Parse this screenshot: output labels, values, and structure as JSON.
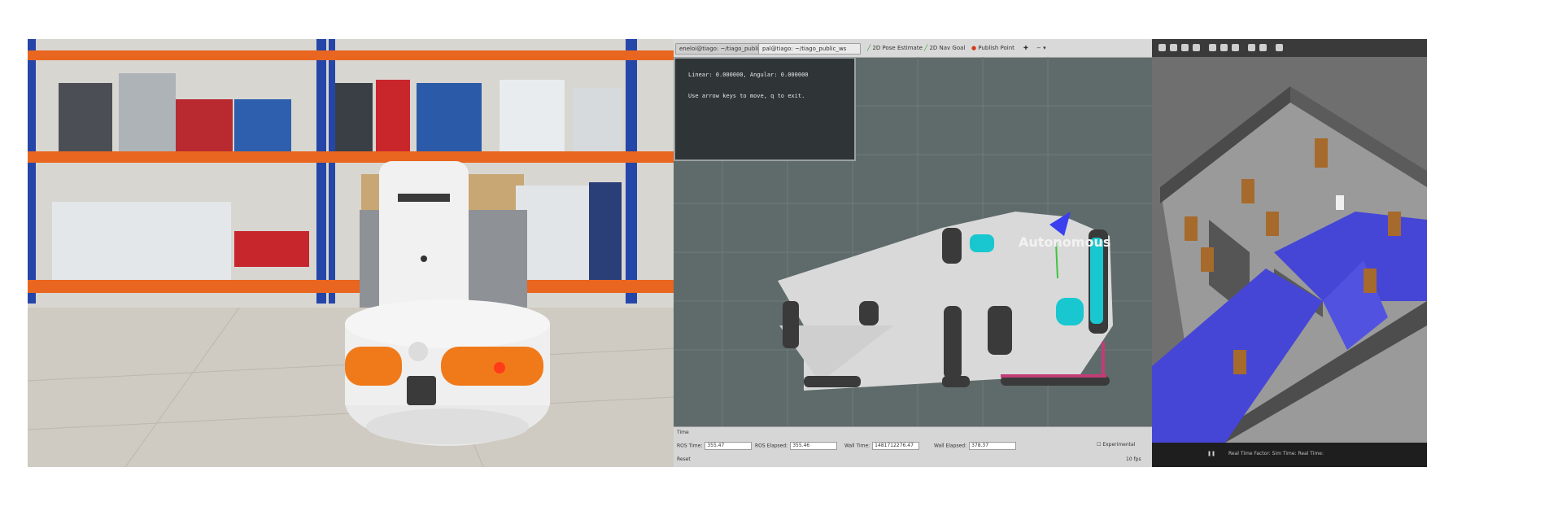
{
  "rviz": {
    "tabs": [
      "eneloi@tiago: ~/tiago_public_w...",
      "pal@tiago: ~/tiago_public_ws"
    ],
    "tools": [
      "2D Pose Estimate",
      "2D Nav Goal",
      "Publish Point"
    ],
    "terminal_lines": [
      "Linear: 0.000000, Angular: 0.000000",
      "Use arrow keys to move, q to exit."
    ],
    "robot_label": "Autonomous",
    "time_title": "Time",
    "time_fields": [
      {
        "label": "ROS Time:",
        "value": "355.47"
      },
      {
        "label": "ROS Elapsed:",
        "value": "355.46"
      },
      {
        "label": "Wall Time:",
        "value": "1481712276.47"
      },
      {
        "label": "Wall Elapsed:",
        "value": "378.37"
      }
    ],
    "experimental_label": "Experimental",
    "fps": "10 fps",
    "reset_label": "Reset"
  },
  "gazebo": {
    "status": "Real Time Factor:   Sim Time:   Real Time:"
  },
  "colors": {
    "costmap_cyan": "#18c7cf",
    "nav_blue": "#3a3ff0",
    "robot_orange": "#f07a1a",
    "shelf_orange": "#e8661f"
  }
}
